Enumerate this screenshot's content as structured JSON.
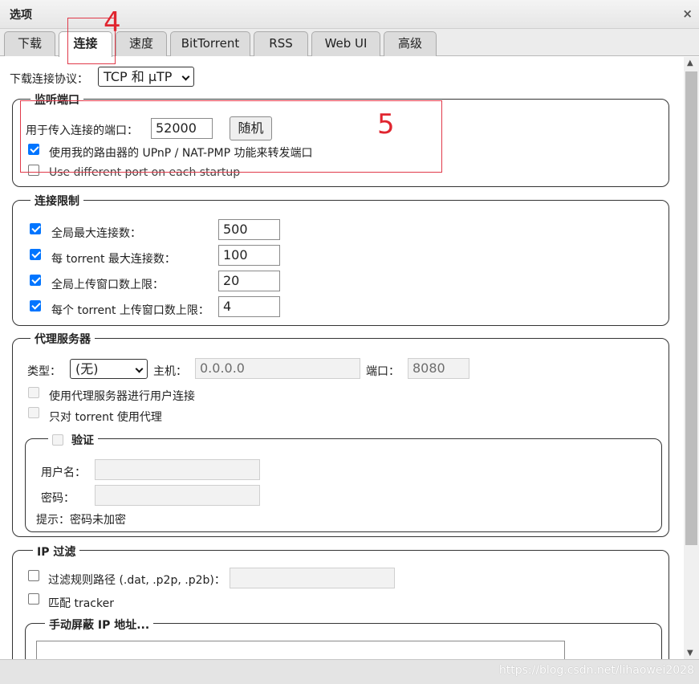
{
  "window": {
    "title": "选项",
    "close_glyph": "×"
  },
  "tabs": [
    {
      "label": "下载"
    },
    {
      "label": "连接"
    },
    {
      "label": "速度"
    },
    {
      "label": "BitTorrent"
    },
    {
      "label": "RSS"
    },
    {
      "label": "Web UI"
    },
    {
      "label": "高级"
    }
  ],
  "active_tab": "连接",
  "annotations": {
    "tab_marker": "4",
    "box_marker": "5",
    "color": "#e0252f"
  },
  "protocol": {
    "label": "下载连接协议：",
    "value": "TCP 和 μTP"
  },
  "listening": {
    "legend": "监听端口",
    "port_label": "用于传入连接的端口：",
    "port_value": "52000",
    "random_button": "随机",
    "upnp_label": "使用我的路由器的 UPnP / NAT-PMP 功能来转发端口",
    "upnp_checked": true,
    "diffport_label": "Use different port on each startup",
    "diffport_checked": false
  },
  "limits": {
    "legend": "连接限制",
    "rows": [
      {
        "label": "全局最大连接数：",
        "value": "500",
        "checked": true
      },
      {
        "label": "每 torrent 最大连接数：",
        "value": "100",
        "checked": true
      },
      {
        "label": "全局上传窗口数上限：",
        "value": "20",
        "checked": true
      },
      {
        "label": "每个 torrent 上传窗口数上限：",
        "value": "4",
        "checked": true
      }
    ]
  },
  "proxy": {
    "legend": "代理服务器",
    "type_label": "类型：",
    "type_value": "(无)",
    "host_label": "主机：",
    "host_value": "0.0.0.0",
    "port_label": "端口：",
    "port_value": "8080",
    "peer_label": "使用代理服务器进行用户连接",
    "only_torrents_label": "只对 torrent 使用代理",
    "auth": {
      "legend": "验证",
      "username_label": "用户名：",
      "password_label": "密码：",
      "hint": "提示：密码未加密"
    }
  },
  "ipfilter": {
    "legend": "IP 过滤",
    "path_label": "过滤规则路径 (.dat, .p2p, .p2b)：",
    "tracker_label": "匹配 tracker",
    "banned_legend": "手动屏蔽 IP 地址..."
  },
  "watermark": "https://blog.csdn.net/lihaowei2028"
}
